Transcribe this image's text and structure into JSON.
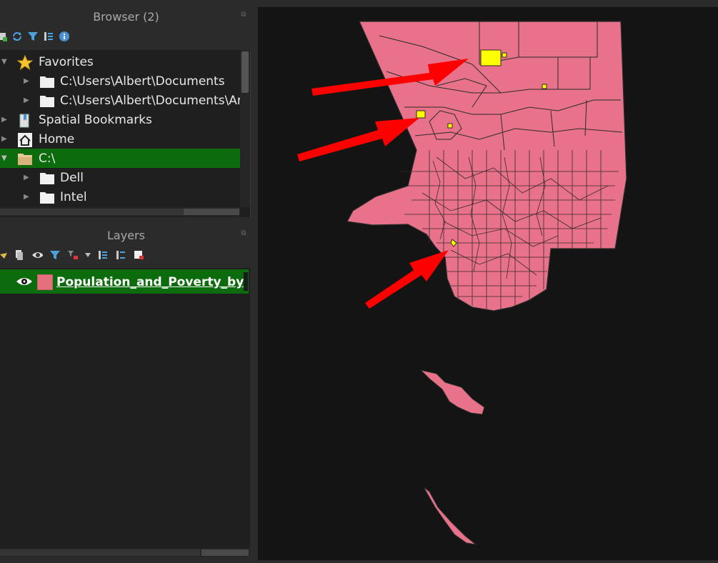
{
  "browser": {
    "title": "Browser (2)",
    "items": [
      {
        "label": "Favorites",
        "icon": "star-icon",
        "expanded": true
      },
      {
        "label": "C:\\Users\\Albert\\Documents",
        "icon": "folder-icon"
      },
      {
        "label": "C:\\Users\\Albert\\Documents\\ArcGIS",
        "icon": "folder-icon"
      },
      {
        "label": "Spatial Bookmarks",
        "icon": "bookmark-icon"
      },
      {
        "label": "Home",
        "icon": "home-icon"
      },
      {
        "label": "C:\\",
        "icon": "drive-folder-icon",
        "selected": true,
        "expanded": true
      },
      {
        "label": "Dell",
        "icon": "folder-icon"
      },
      {
        "label": "Intel",
        "icon": "folder-icon"
      }
    ]
  },
  "layers": {
    "title": "Layers",
    "items": [
      {
        "name": "Population_and_Poverty_by_Census_Tract",
        "visible": true,
        "color": "#e46f7d"
      }
    ]
  },
  "map": {
    "background": "#141414",
    "fill_color": "#e8728a",
    "highlight_color": "#ffff00",
    "arrow_color": "#ff0000"
  }
}
